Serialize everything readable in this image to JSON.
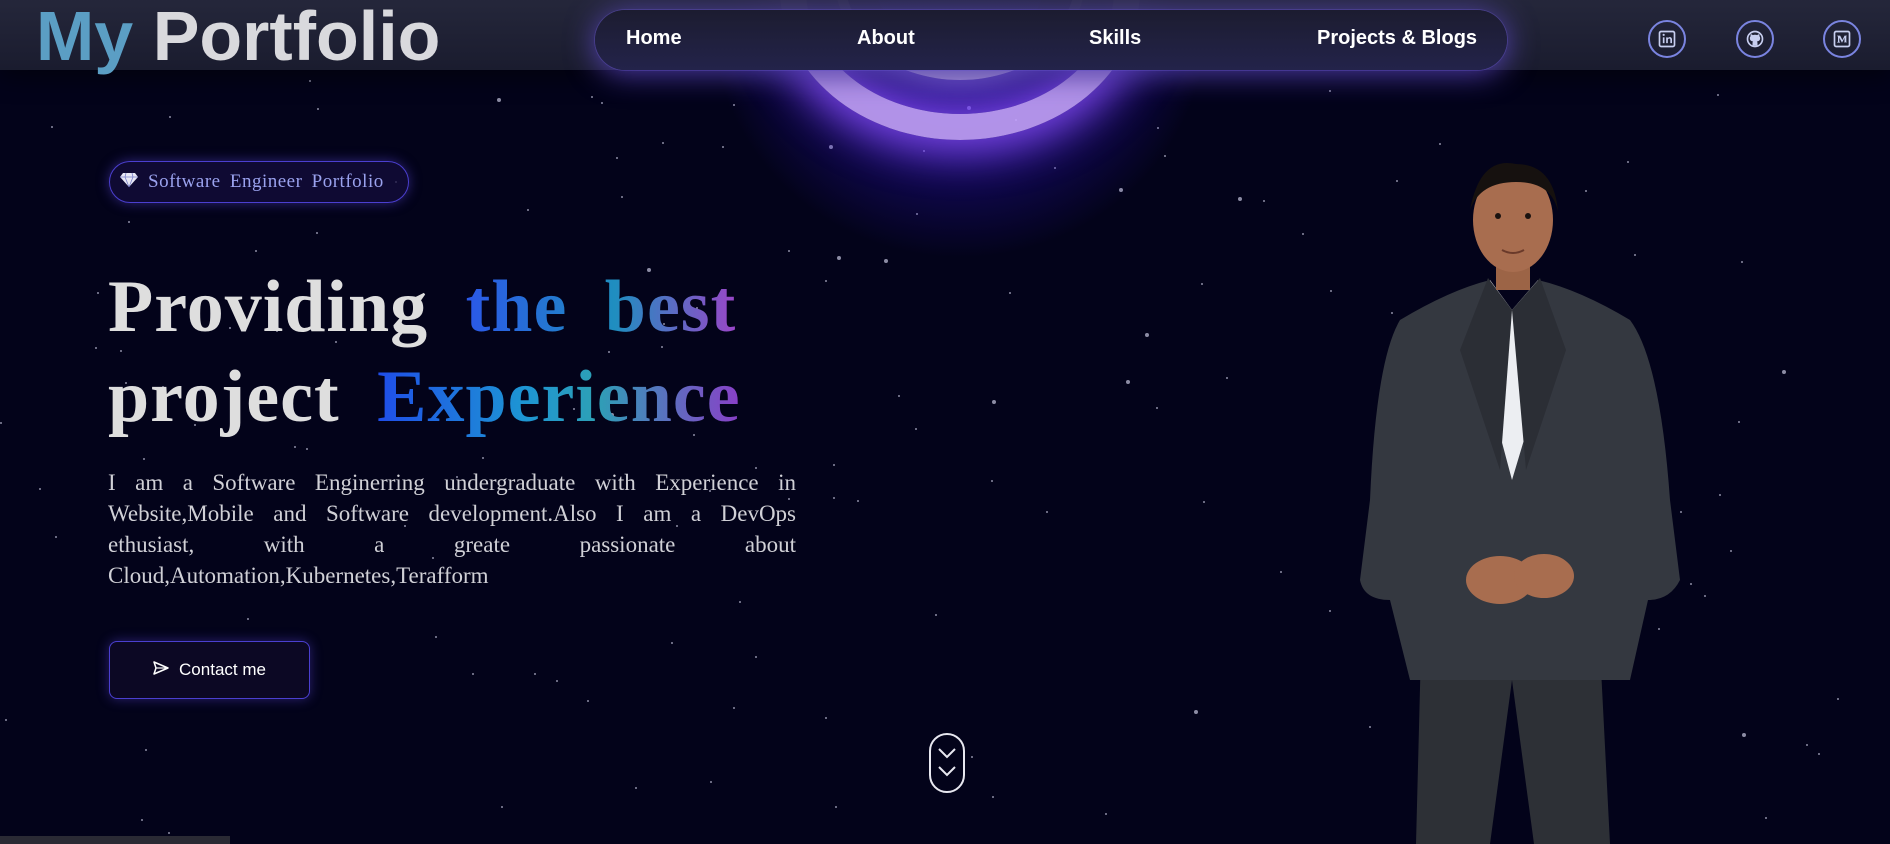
{
  "header": {
    "logo_part1": "My",
    "logo_part2": "Portfolio",
    "nav": [
      "Home",
      "About",
      "Skills",
      "Projects & Blogs"
    ],
    "social": [
      "linkedin-icon",
      "github-icon",
      "medium-icon"
    ]
  },
  "hero": {
    "badge": "Software Engineer Portfolio",
    "headline_line1_a": "Providing",
    "headline_line1_b": "the best",
    "headline_line2_a": "project",
    "headline_line2_b": "Experience",
    "description": "I am a Software Enginerring undergraduate with Experience in Website,Mobile and Software development.Also I am a DevOps ethusiast, with a greate passionate about Cloud,Automation,Kubernetes,Terafform",
    "cta_label": "Contact me"
  },
  "colors": {
    "background": "#03031a",
    "accent": "#4b3fd0",
    "logo_my": "#5b9ec4"
  }
}
